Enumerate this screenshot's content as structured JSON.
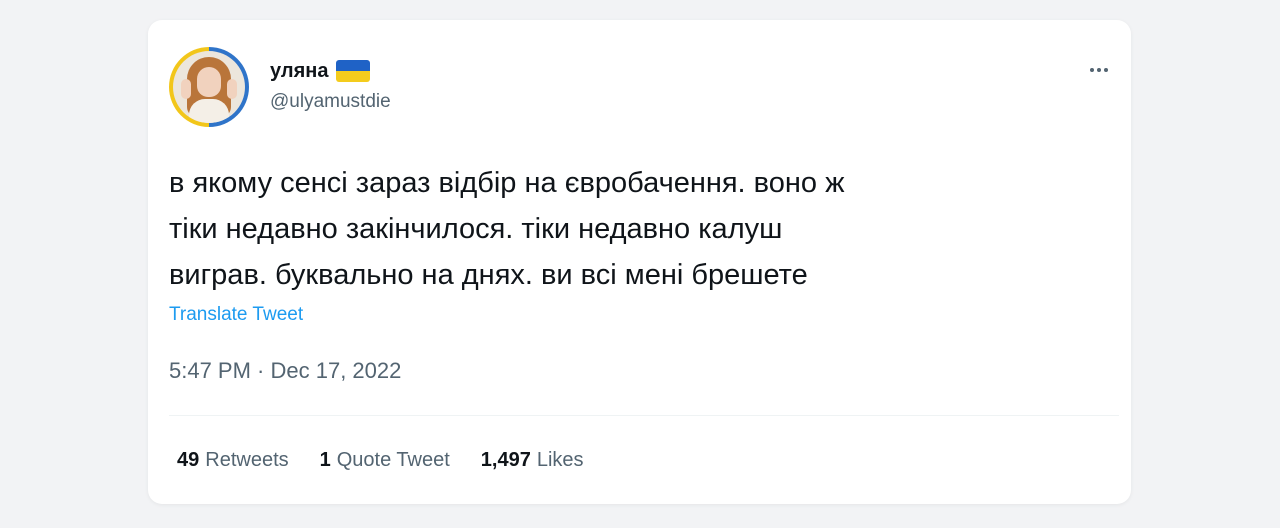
{
  "tweet": {
    "author_name": "уляна",
    "author_handle": "@ulyamustdie",
    "text": "в якому сенсі зараз відбір на євробачення. воно ж\nтіки недавно закінчилося. тіки недавно калуш\nвиграв. буквально на днях. ви всі мені брешете",
    "translate_label": "Translate Tweet",
    "timestamp": "5:47 PM · Dec 17, 2022"
  },
  "icons": {
    "flag": "ukraine-flag-emoji",
    "more": "more-options-icon",
    "avatar": "profile-avatar"
  },
  "stats": [
    {
      "count": "49",
      "label": "Retweets"
    },
    {
      "count": "1",
      "label": "Quote Tweet"
    },
    {
      "count": "1,497",
      "label": "Likes"
    }
  ],
  "colors": {
    "text": "#0f1419",
    "secondary": "#536471",
    "link": "#1d9bf0",
    "flag_blue": "#1f62c6",
    "flag_yellow": "#f4cc1d"
  }
}
